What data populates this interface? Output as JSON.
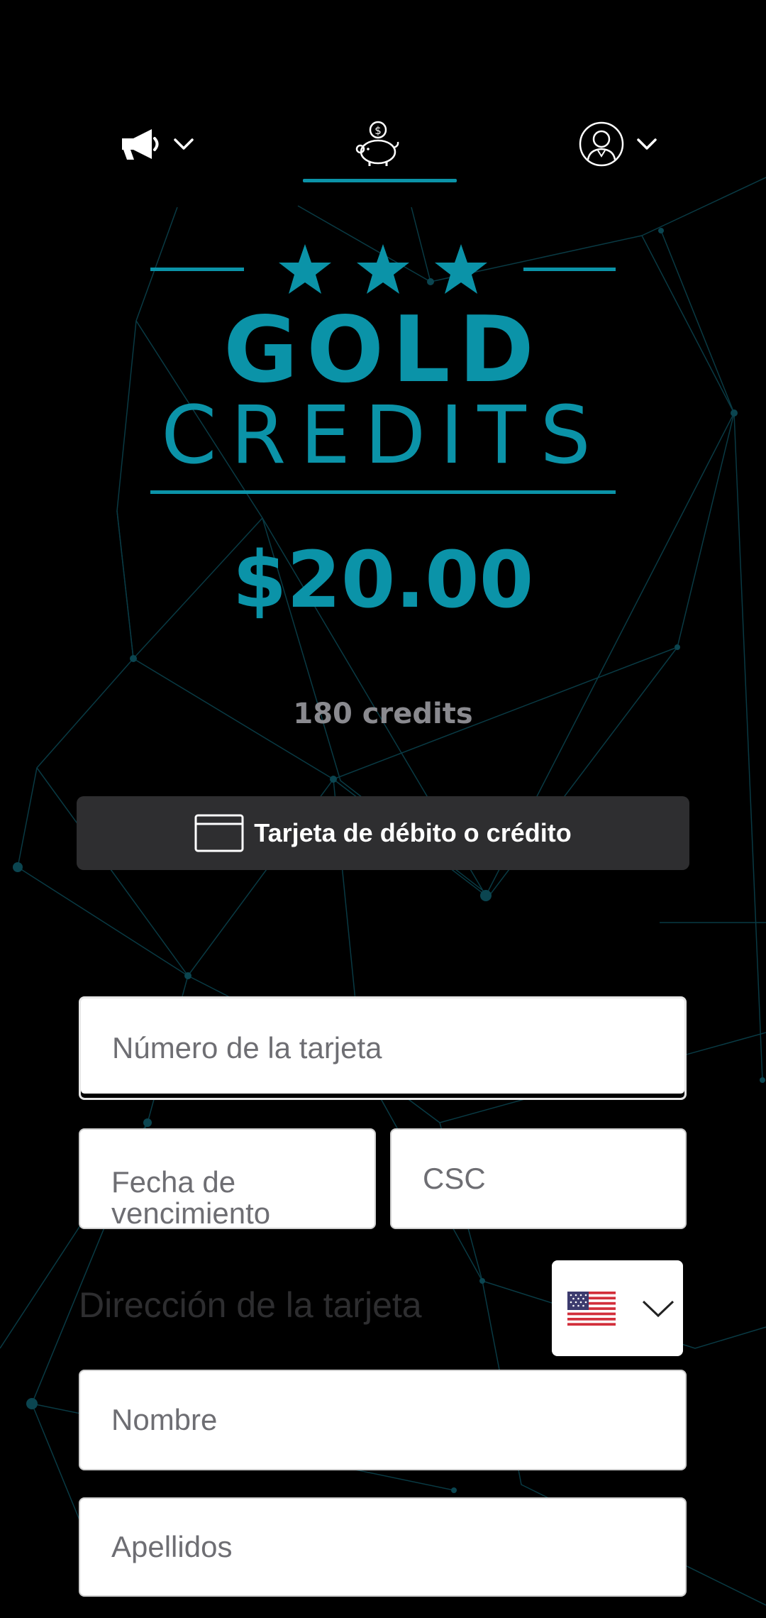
{
  "nav": {
    "items": [
      {
        "icon": "megaphone-icon",
        "has_dropdown": true
      },
      {
        "icon": "piggy-bank-icon",
        "active": true
      },
      {
        "icon": "profile-icon",
        "has_dropdown": true
      }
    ]
  },
  "product": {
    "title_top": "GOLD",
    "title_bottom": "CREDITS",
    "star_count": 3,
    "price": "$20.00",
    "credits": "180 credits"
  },
  "payment": {
    "method_label": "Tarjeta de débito o crédito",
    "method_icon": "card-icon"
  },
  "form": {
    "card_number_placeholder": "Número de la tarjeta",
    "expiry_placeholder": "Fecha de vencimiento",
    "csc_placeholder": "CSC",
    "address_label": "Dirección de la tarjeta",
    "country_flag": "us-flag-icon",
    "first_name_placeholder": "Nombre",
    "last_name_placeholder": "Apellidos"
  },
  "colors": {
    "accent": "#0b93a8",
    "background": "#000000",
    "button_bg": "#2e2e30",
    "muted_text": "#8a8a8f"
  }
}
